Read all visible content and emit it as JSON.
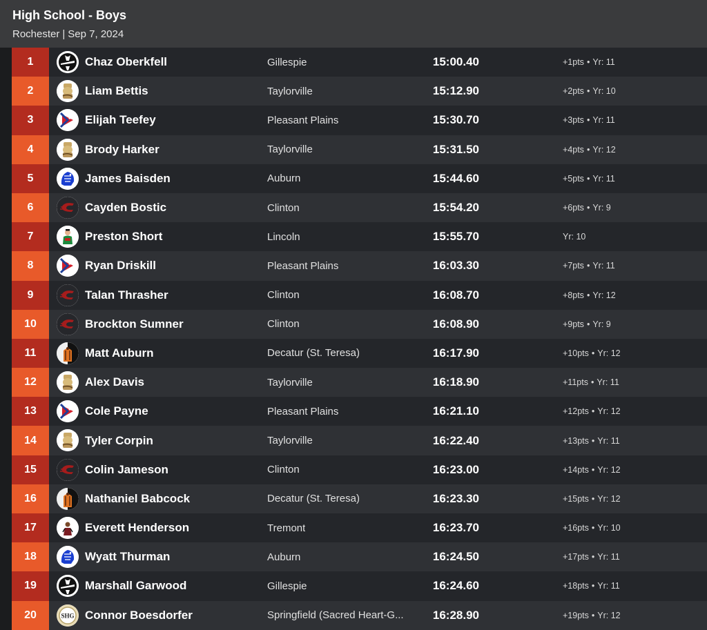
{
  "header": {
    "title": "High School - Boys",
    "location": "Rochester",
    "separator": "|",
    "date": "Sep 7, 2024"
  },
  "colors": {
    "place_dark": "#b32c1f",
    "place_light": "#e85a2a",
    "row_dark": "#24262a",
    "row_light": "#2f3135",
    "header_bg": "#3a3b3d"
  },
  "results": [
    {
      "place": "1",
      "name": "Chaz Oberkfell",
      "school": "Gillespie",
      "time": "15:00.40",
      "pts": "+1pts",
      "year": "Yr: 11",
      "logo": "gillespie-logo-icon"
    },
    {
      "place": "2",
      "name": "Liam Bettis",
      "school": "Taylorville",
      "time": "15:12.90",
      "pts": "+2pts",
      "year": "Yr: 10",
      "logo": "taylorville-logo-icon"
    },
    {
      "place": "3",
      "name": "Elijah Teefey",
      "school": "Pleasant Plains",
      "time": "15:30.70",
      "pts": "+3pts",
      "year": "Yr: 11",
      "logo": "pleasant-plains-logo-icon"
    },
    {
      "place": "4",
      "name": "Brody Harker",
      "school": "Taylorville",
      "time": "15:31.50",
      "pts": "+4pts",
      "year": "Yr: 12",
      "logo": "taylorville-logo-icon"
    },
    {
      "place": "5",
      "name": "James Baisden",
      "school": "Auburn",
      "time": "15:44.60",
      "pts": "+5pts",
      "year": "Yr: 11",
      "logo": "auburn-logo-icon"
    },
    {
      "place": "6",
      "name": "Cayden Bostic",
      "school": "Clinton",
      "time": "15:54.20",
      "pts": "+6pts",
      "year": "Yr: 9",
      "logo": "clinton-logo-icon"
    },
    {
      "place": "7",
      "name": "Preston Short",
      "school": "Lincoln",
      "time": "15:55.70",
      "pts": "",
      "year": "Yr: 10",
      "logo": "lincoln-logo-icon"
    },
    {
      "place": "8",
      "name": "Ryan Driskill",
      "school": "Pleasant Plains",
      "time": "16:03.30",
      "pts": "+7pts",
      "year": "Yr: 11",
      "logo": "pleasant-plains-logo-icon"
    },
    {
      "place": "9",
      "name": "Talan Thrasher",
      "school": "Clinton",
      "time": "16:08.70",
      "pts": "+8pts",
      "year": "Yr: 12",
      "logo": "clinton-logo-icon"
    },
    {
      "place": "10",
      "name": "Brockton Sumner",
      "school": "Clinton",
      "time": "16:08.90",
      "pts": "+9pts",
      "year": "Yr: 9",
      "logo": "clinton-logo-icon"
    },
    {
      "place": "11",
      "name": "Matt Auburn",
      "school": "Decatur (St. Teresa)",
      "time": "16:17.90",
      "pts": "+10pts",
      "year": "Yr: 12",
      "logo": "st-teresa-logo-icon"
    },
    {
      "place": "12",
      "name": "Alex Davis",
      "school": "Taylorville",
      "time": "16:18.90",
      "pts": "+11pts",
      "year": "Yr: 11",
      "logo": "taylorville-logo-icon"
    },
    {
      "place": "13",
      "name": "Cole Payne",
      "school": "Pleasant Plains",
      "time": "16:21.10",
      "pts": "+12pts",
      "year": "Yr: 12",
      "logo": "pleasant-plains-logo-icon"
    },
    {
      "place": "14",
      "name": "Tyler Corpin",
      "school": "Taylorville",
      "time": "16:22.40",
      "pts": "+13pts",
      "year": "Yr: 11",
      "logo": "taylorville-logo-icon"
    },
    {
      "place": "15",
      "name": "Colin Jameson",
      "school": "Clinton",
      "time": "16:23.00",
      "pts": "+14pts",
      "year": "Yr: 12",
      "logo": "clinton-logo-icon"
    },
    {
      "place": "16",
      "name": "Nathaniel Babcock",
      "school": "Decatur (St. Teresa)",
      "time": "16:23.30",
      "pts": "+15pts",
      "year": "Yr: 12",
      "logo": "st-teresa-logo-icon"
    },
    {
      "place": "17",
      "name": "Everett Henderson",
      "school": "Tremont",
      "time": "16:23.70",
      "pts": "+16pts",
      "year": "Yr: 10",
      "logo": "tremont-logo-icon"
    },
    {
      "place": "18",
      "name": "Wyatt Thurman",
      "school": "Auburn",
      "time": "16:24.50",
      "pts": "+17pts",
      "year": "Yr: 11",
      "logo": "auburn-logo-icon"
    },
    {
      "place": "19",
      "name": "Marshall Garwood",
      "school": "Gillespie",
      "time": "16:24.60",
      "pts": "+18pts",
      "year": "Yr: 11",
      "logo": "gillespie-logo-icon"
    },
    {
      "place": "20",
      "name": "Connor Boesdorfer",
      "school": "Springfield (Sacred Heart-G...",
      "time": "16:28.90",
      "pts": "+19pts",
      "year": "Yr: 12",
      "logo": "sacred-heart-griffin-logo-icon"
    }
  ]
}
